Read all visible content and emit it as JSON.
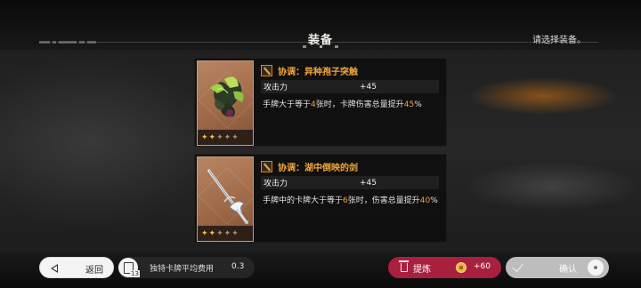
{
  "header": {
    "title": "装备",
    "hint": "请选择装备。"
  },
  "items": [
    {
      "name": "协调：异种孢子突触",
      "stat_label": "攻击力",
      "stat_value": "+45",
      "desc_pre": "手牌大于等于",
      "desc_n": "4",
      "desc_mid": "张时，卡牌伤害总量提升",
      "desc_pct": "45",
      "desc_post": "%",
      "rarity": 2,
      "rarity_max": 5,
      "art_icon": "spore-synapse-art",
      "type_icon": "sword-icon"
    },
    {
      "name": "协调：湖中倒映的剑",
      "stat_label": "攻击力",
      "stat_value": "+45",
      "desc_pre": "手牌中的卡牌大于等于",
      "desc_n": "6",
      "desc_mid": "张时，伤害总量提升",
      "desc_pct": "40",
      "desc_post": "%",
      "rarity": 2,
      "rarity_max": 5,
      "art_icon": "reflected-sword-art",
      "type_icon": "sword-icon"
    }
  ],
  "footer": {
    "back_label": "返回",
    "avg_label": "独特卡牌平均费用",
    "avg_value": "0.3",
    "card_count": "13",
    "refine_label": "提炼",
    "refine_gain": "+60",
    "confirm_label": "确认"
  },
  "colors": {
    "accent": "#f0a63a",
    "refine": "#a8203d",
    "confirm": "#bdbdbd"
  }
}
